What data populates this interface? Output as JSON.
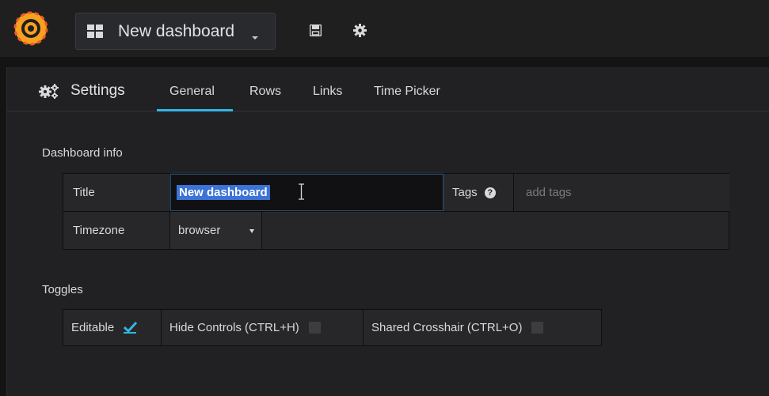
{
  "navbar": {
    "dashboard_title": "New dashboard",
    "logo_icon": "grafana-logo-icon",
    "grid_icon": "dashboard-grid-icon",
    "save_icon": "save-icon",
    "settings_icon": "gear-icon"
  },
  "settings": {
    "title": "Settings",
    "tabs": [
      {
        "label": "General",
        "active": true
      },
      {
        "label": "Rows",
        "active": false
      },
      {
        "label": "Links",
        "active": false
      },
      {
        "label": "Time Picker",
        "active": false
      }
    ],
    "accent_color": "#33b5e5"
  },
  "dashboard_info": {
    "section_title": "Dashboard info",
    "title_label": "Title",
    "title_value": "New dashboard",
    "tags_label": "Tags",
    "tags_help": "?",
    "tags_placeholder": "add tags",
    "timezone_label": "Timezone",
    "timezone_value": "browser"
  },
  "toggles": {
    "section_title": "Toggles",
    "items": [
      {
        "label": "Editable",
        "checked": true
      },
      {
        "label": "Hide Controls (CTRL+H)",
        "checked": false
      },
      {
        "label": "Shared Crosshair (CTRL+O)",
        "checked": false
      }
    ]
  }
}
